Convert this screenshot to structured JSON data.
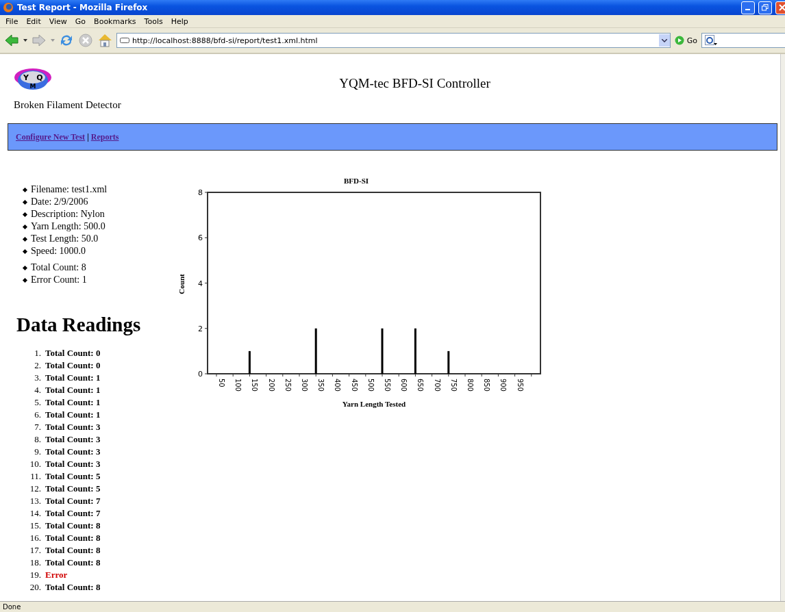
{
  "window": {
    "title": "Test Report - Mozilla Firefox"
  },
  "menu": [
    "File",
    "Edit",
    "View",
    "Go",
    "Bookmarks",
    "Tools",
    "Help"
  ],
  "toolbar": {
    "url": "http://localhost:8888/bfd-si/report/test1.xml.html",
    "go_label": "Go"
  },
  "page": {
    "logo_letters": [
      "Y",
      "Q",
      "M"
    ],
    "title": "YQM-tec BFD-SI Controller",
    "subtitle": "Broken Filament Detector",
    "nav": [
      {
        "label": "Configure New Test"
      },
      {
        "label": "Reports"
      }
    ],
    "nav_separator": "|",
    "info": [
      "Filename: test1.xml",
      "Date: 2/9/2006",
      "Description: Nylon",
      "Yarn Length: 500.0",
      "Test Length: 50.0",
      "Speed: 1000.0"
    ],
    "counts": [
      "Total Count: 8",
      "Error Count: 1"
    ],
    "readings_heading": "Data Readings",
    "readings": [
      {
        "number": "1.",
        "text": "Total Count: 0",
        "kind": "count"
      },
      {
        "number": "2.",
        "text": "Total Count: 0",
        "kind": "count"
      },
      {
        "number": "3.",
        "text": "Total Count: 1",
        "kind": "count"
      },
      {
        "number": "4.",
        "text": "Total Count: 1",
        "kind": "count"
      },
      {
        "number": "5.",
        "text": "Total Count: 1",
        "kind": "count"
      },
      {
        "number": "6.",
        "text": "Total Count: 1",
        "kind": "count"
      },
      {
        "number": "7.",
        "text": "Total Count: 3",
        "kind": "count"
      },
      {
        "number": "8.",
        "text": "Total Count: 3",
        "kind": "count"
      },
      {
        "number": "9.",
        "text": "Total Count: 3",
        "kind": "count"
      },
      {
        "number": "10.",
        "text": "Total Count: 3",
        "kind": "count"
      },
      {
        "number": "11.",
        "text": "Total Count: 5",
        "kind": "count"
      },
      {
        "number": "12.",
        "text": "Total Count: 5",
        "kind": "count"
      },
      {
        "number": "13.",
        "text": "Total Count: 7",
        "kind": "count"
      },
      {
        "number": "14.",
        "text": "Total Count: 7",
        "kind": "count"
      },
      {
        "number": "15.",
        "text": "Total Count: 8",
        "kind": "count"
      },
      {
        "number": "16.",
        "text": "Total Count: 8",
        "kind": "count"
      },
      {
        "number": "17.",
        "text": "Total Count: 8",
        "kind": "count"
      },
      {
        "number": "18.",
        "text": "Total Count: 8",
        "kind": "count"
      },
      {
        "number": "19.",
        "text": "Error",
        "kind": "error"
      },
      {
        "number": "20.",
        "text": "Total Count: 8",
        "kind": "count"
      }
    ],
    "chart_data": {
      "type": "bar",
      "title": "BFD-SI",
      "xlabel": "Yarn Length Tested",
      "ylabel": "Count",
      "categories": [
        "50",
        "100",
        "150",
        "200",
        "250",
        "300",
        "350",
        "400",
        "450",
        "500",
        "550",
        "600",
        "650",
        "700",
        "750",
        "800",
        "850",
        "900",
        "950"
      ],
      "values": [
        0,
        0,
        1,
        0,
        0,
        0,
        2,
        0,
        0,
        0,
        2,
        0,
        2,
        0,
        1,
        0,
        0,
        0,
        0
      ],
      "ylim": [
        0,
        8
      ],
      "yticks": [
        0,
        2,
        4,
        6,
        8
      ]
    }
  },
  "status_bar": "Done"
}
